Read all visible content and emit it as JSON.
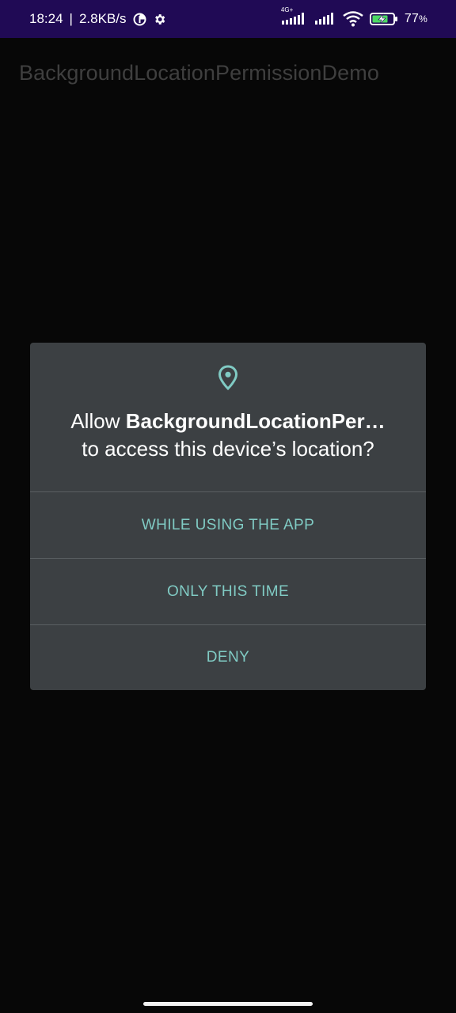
{
  "status_bar": {
    "time": "18:24",
    "separator": "|",
    "net_speed": "2.8KB/s",
    "data_saver_icon": "data-saver-icon",
    "settings_icon": "gear-icon",
    "network_label": "4G+",
    "signal1_icon": "signal-icon",
    "signal2_icon": "signal-icon",
    "wifi_icon": "wifi-icon",
    "battery_icon": "battery-charging-icon",
    "battery_percent": "77",
    "battery_percent_unit": "%",
    "battery_level": 0.77
  },
  "app_bar": {
    "title": "BackgroundLocationPermissionDemo"
  },
  "dialog": {
    "icon": "location-pin-icon",
    "message_prefix": "Allow ",
    "app_name": "BackgroundLocationPer…",
    "message_suffix": "to access this device’s location?",
    "buttons": {
      "while_using": "WHILE USING THE APP",
      "only_this_time": "ONLY THIS TIME",
      "deny": "DENY"
    }
  },
  "colors": {
    "status_bar_bg": "#200a55",
    "background": "#070707",
    "dialog_bg": "#3c4043",
    "accent": "#80cbc4",
    "app_title": "#3f3f3f"
  }
}
